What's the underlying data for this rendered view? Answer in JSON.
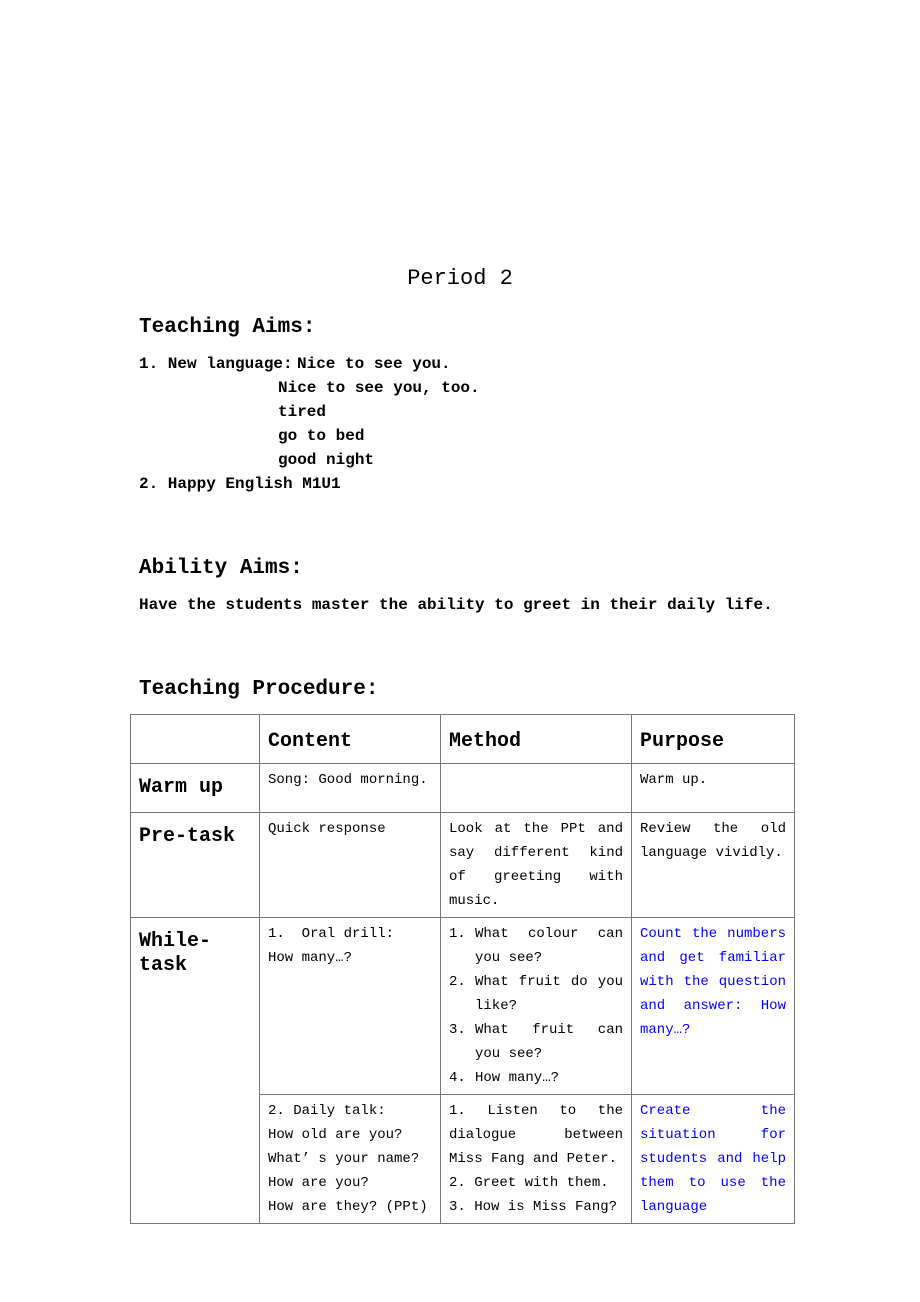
{
  "title": "Period 2",
  "teaching_aims": {
    "heading": "Teaching Aims:",
    "item1_label": "1. New language:",
    "item1_lines": [
      "Nice to see you.",
      "Nice to see you, too.",
      "tired",
      "go to bed",
      "good night"
    ],
    "item2": "2. Happy English M1U1"
  },
  "ability_aims": {
    "heading": "Ability Aims:",
    "text": "Have the students master the ability to greet in their daily life."
  },
  "procedure": {
    "heading": "Teaching Procedure:",
    "columns": [
      "",
      "Content",
      "Method",
      "Purpose"
    ],
    "rows": [
      {
        "stage": "Warm up",
        "content": [
          "Song: Good morning."
        ],
        "method": [],
        "purpose": "Warm up."
      },
      {
        "stage": "Pre-task",
        "content": [
          "Quick response"
        ],
        "method_text": "Look at the PPt and say different kind of greeting with music.",
        "purpose": "Review the old language vividly."
      },
      {
        "stage": "While-task",
        "content": [
          "1.  Oral drill:",
          "How many…?"
        ],
        "method": [
          "What colour can you see?",
          "What fruit do you like?",
          "What fruit can you see?",
          "How many…?"
        ],
        "purpose": "Count the numbers and get familiar with the question and answer: How many…?"
      },
      {
        "stage": "",
        "content": [
          "2. Daily talk:",
          "How old are you?",
          "What’ s your name?",
          "How are you?",
          "How are they? (PPt)"
        ],
        "method_text": "1.  Listen to the dialogue between Miss Fang and Peter.",
        "method_lines": [
          "2. Greet with them.",
          "3. How is Miss Fang?"
        ],
        "purpose": "Create the situation for students and help them to use the language"
      }
    ],
    "accent_color": "#0000ff"
  }
}
